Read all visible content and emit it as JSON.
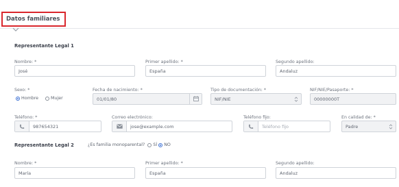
{
  "section": {
    "title": "Datos familiares"
  },
  "rep1": {
    "heading": "Representante Legal 1",
    "nombre": {
      "label": "Nombre: *",
      "value": "José"
    },
    "apellido1": {
      "label": "Primer apellido: *",
      "value": "España"
    },
    "apellido2": {
      "label": "Segundo apellido:",
      "value": "Andaluz"
    },
    "sexo": {
      "label": "Sexo: *",
      "options": [
        "Hombre",
        "Mujer"
      ],
      "selected": "Hombre"
    },
    "fecha": {
      "label": "Fecha de nacimiento: *",
      "value": "01/01/80"
    },
    "tipo_doc": {
      "label": "Tipo de documentación: *",
      "value": "NIF/NIE"
    },
    "nif": {
      "label": "NIF/NIE/Pasaporte: *",
      "value": "00000000T"
    },
    "telefono": {
      "label": "Teléfono: *",
      "value": "987654321"
    },
    "correo": {
      "label": "Correo electrónico:",
      "value": "jose@example.com"
    },
    "tel_fijo": {
      "label": "Teléfono fijo:",
      "placeholder": "Teléfono fijo"
    },
    "calidad": {
      "label": "En calidad de: *",
      "value": "Padre"
    }
  },
  "rep2": {
    "heading": "Representante Legal 2",
    "monoparental": {
      "question": "¿Es familia monoparental?",
      "options": [
        "SÍ",
        "NO"
      ],
      "selected": "NO"
    },
    "nombre": {
      "label": "Nombre: *",
      "value": "María"
    },
    "apellido1": {
      "label": "Primer apellido: *",
      "value": "España"
    },
    "apellido2": {
      "label": "Segundo apellido:",
      "value": "Andaluz"
    }
  },
  "colors": {
    "accent": "#3b6fd4",
    "highlight_border": "#d9262c",
    "border": "#cfd3d9"
  },
  "icons": [
    "chevron-down-icon",
    "phone-icon",
    "envelope-icon",
    "calendar-icon",
    "select-arrows-icon"
  ]
}
